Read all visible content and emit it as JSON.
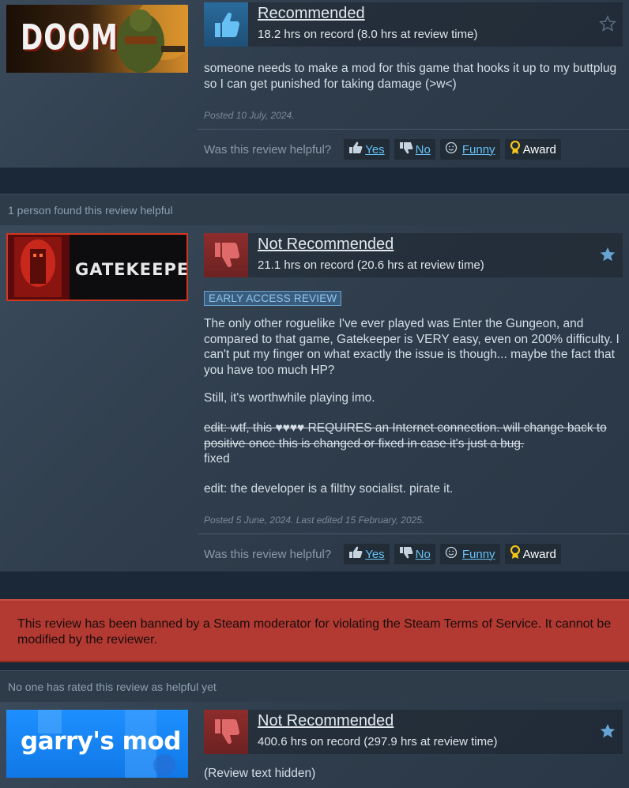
{
  "reviews": [
    {
      "game": "DOOM",
      "verdict": "Recommended",
      "hours": "18.2 hrs on record (8.0 hrs at review time)",
      "text": "someone needs to make a mod for this game that hooks it up to my buttplug so I can get punished for taking damage (>w<)",
      "posted": "Posted 10 July, 2024."
    },
    {
      "game": "GATEKEEPER",
      "helpful_count": "1 person found this review helpful",
      "verdict": "Not Recommended",
      "hours": "21.1 hrs on record (20.6 hrs at review time)",
      "badge": "EARLY ACCESS REVIEW",
      "p1": "The only other roguelike I've ever played was Enter the Gungeon, and compared to that game, Gatekeeper is VERY easy, even on 200% difficulty. I can't put my finger on what exactly the issue is though... maybe the fact that you have too much HP?",
      "p2": "Still, it's worthwhile playing imo.",
      "p3_strike": "edit: wtf, this ♥♥♥♥ REQUIRES an Internet connection. will change back to positive once this is changed or fixed in case it's just a bug.",
      "p3_after": "fixed",
      "p4": "edit: the developer is a filthy socialist. pirate it.",
      "posted": "Posted 5 June, 2024. Last edited 15 February, 2025."
    },
    {
      "game": "garry's mod",
      "ban_notice": "This review has been banned by a Steam moderator for violating the Steam Terms of Service. It cannot be modified by the reviewer.",
      "helpful_count": "No one has rated this review as helpful yet",
      "verdict": "Not Recommended",
      "hours": "400.6 hrs on record (297.9 hrs at review time)",
      "text": "(Review text hidden)"
    }
  ],
  "helpful": {
    "question": "Was this review helpful?",
    "yes": "Yes",
    "no": "No",
    "funny": "Funny",
    "award": "Award"
  },
  "colors": {
    "background": "#1b2838",
    "link": "#67c1f5",
    "recommended": "#2a6b9c",
    "not_recommended": "#8e2c2c",
    "ban": "#b23a32"
  }
}
